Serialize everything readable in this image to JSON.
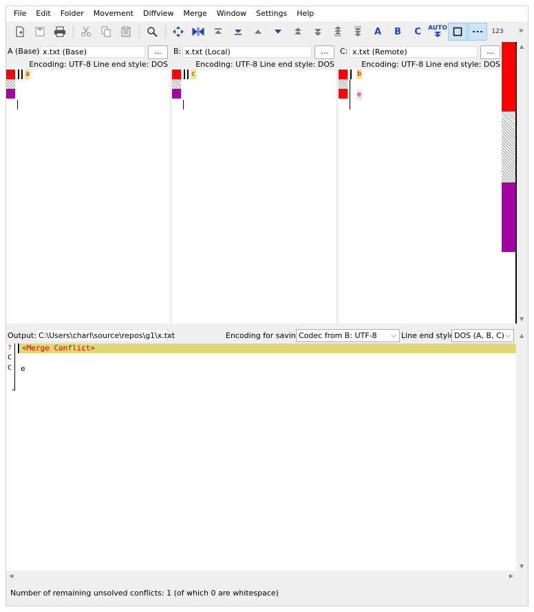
{
  "menu": [
    "File",
    "Edit",
    "Folder",
    "Movement",
    "Diffview",
    "Merge",
    "Window",
    "Settings",
    "Help"
  ],
  "panes": [
    {
      "label": "A (Base):",
      "file": "x.txt (Base)",
      "browse": "...",
      "encoding": "Encoding: UTF-8 Line end style: DOS",
      "line1": "a"
    },
    {
      "label": "B:",
      "file": "x.txt (Local)",
      "browse": "...",
      "encoding": "Encoding: UTF-8 Line end style: DOS",
      "line1": "c"
    },
    {
      "label": "C:",
      "file": "x.txt (Remote)",
      "browse": "...",
      "encoding": "Encoding: UTF-8 Line end style: DOS",
      "line1": "b",
      "line3": "e"
    }
  ],
  "toolbar": {
    "auto_label": "AUTO",
    "letter_a": "A",
    "letter_b": "B",
    "letter_c": "C",
    "num_label": "123",
    "overflow": "»"
  },
  "output": {
    "label": "Output:",
    "path": "C:\\Users\\charl\\source\\repos\\g1\\x.txt",
    "encoding_label": "Encoding for saving:",
    "encoding_value": "Codec from B: UTF-8",
    "line_end_label": "Line end style:",
    "line_end_value": "DOS (A, B, C)",
    "conflict_text": "<Merge Conflict>",
    "gutter": [
      "?",
      "C",
      "C"
    ],
    "line_e": "e"
  },
  "status": "Number of remaining unsolved conflicts: 1 (of which 0 are whitespace)",
  "colors": {
    "conflict_bg": "#e0d870",
    "red": "#ff0000",
    "purple": "#a000a0"
  }
}
